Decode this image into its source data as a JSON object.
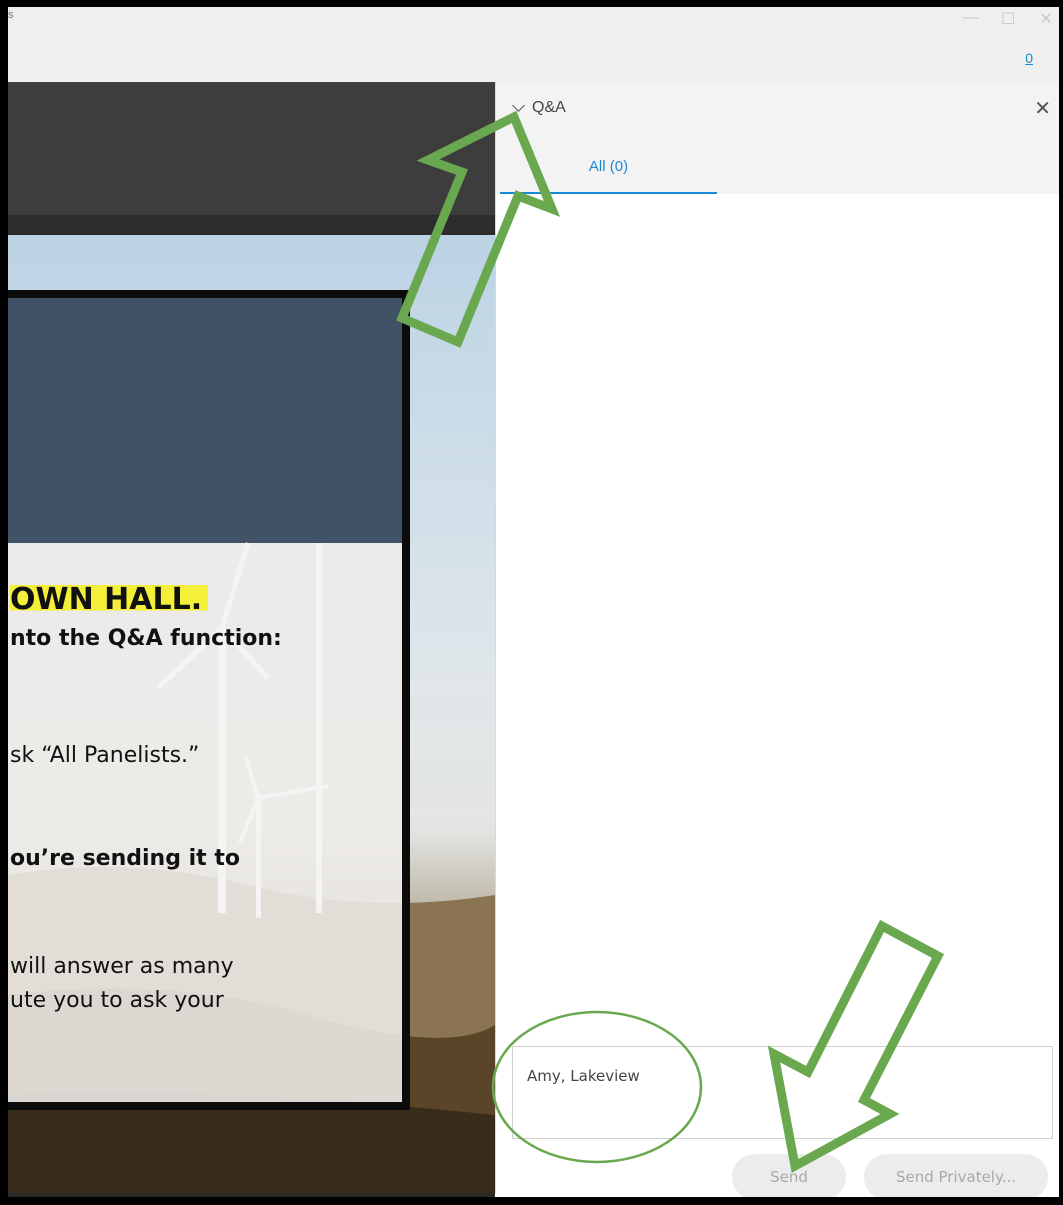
{
  "window": {
    "title_fragment": "s",
    "controls": [
      "minimize-icon",
      "maximize-icon",
      "close-icon"
    ],
    "help_link": "0"
  },
  "slide": {
    "headline": "OWN HALL.",
    "line1": "nto the Q&A function:",
    "line2": "sk “All Panelists.”",
    "line3": "ou’re sending it to",
    "line4": "will answer as many",
    "line5": "ute you to ask your",
    "colors": {
      "header": "#415266",
      "highlight": "#f4f03a"
    }
  },
  "qa": {
    "title": "Q&A",
    "close_icon": "close-icon",
    "tab_all": "All (0)",
    "input_value": "Amy, Lakeview",
    "send_label": "Send",
    "send_private_label": "Send Privately..."
  },
  "annotations": {
    "arrow_color": "#6aa84f",
    "circle_color": "#6aa84f"
  }
}
